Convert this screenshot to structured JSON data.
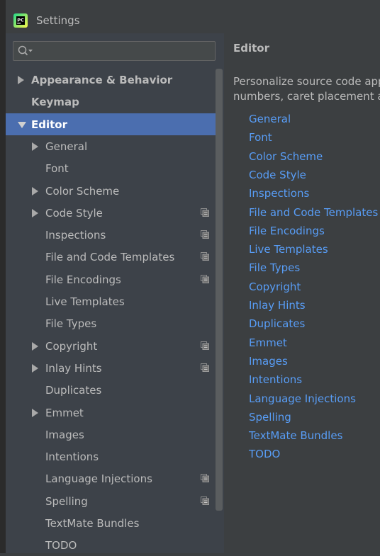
{
  "window": {
    "title": "Settings",
    "app_icon": "pycharm-logo"
  },
  "search": {
    "placeholder": "",
    "value": ""
  },
  "tree": [
    {
      "label": "Appearance & Behavior",
      "bold": true,
      "expander": "collapsed",
      "level": 0,
      "project_icon": false,
      "selected": false
    },
    {
      "label": "Keymap",
      "bold": true,
      "expander": "none",
      "level": 0,
      "project_icon": false,
      "selected": false
    },
    {
      "label": "Editor",
      "bold": true,
      "expander": "expanded",
      "level": 0,
      "project_icon": false,
      "selected": true
    },
    {
      "label": "General",
      "bold": false,
      "expander": "collapsed",
      "level": 1,
      "project_icon": false,
      "selected": false
    },
    {
      "label": "Font",
      "bold": false,
      "expander": "none",
      "level": 1,
      "project_icon": false,
      "selected": false
    },
    {
      "label": "Color Scheme",
      "bold": false,
      "expander": "collapsed",
      "level": 1,
      "project_icon": false,
      "selected": false
    },
    {
      "label": "Code Style",
      "bold": false,
      "expander": "collapsed",
      "level": 1,
      "project_icon": true,
      "selected": false
    },
    {
      "label": "Inspections",
      "bold": false,
      "expander": "none",
      "level": 1,
      "project_icon": true,
      "selected": false
    },
    {
      "label": "File and Code Templates",
      "bold": false,
      "expander": "none",
      "level": 1,
      "project_icon": true,
      "selected": false
    },
    {
      "label": "File Encodings",
      "bold": false,
      "expander": "none",
      "level": 1,
      "project_icon": true,
      "selected": false
    },
    {
      "label": "Live Templates",
      "bold": false,
      "expander": "none",
      "level": 1,
      "project_icon": false,
      "selected": false
    },
    {
      "label": "File Types",
      "bold": false,
      "expander": "none",
      "level": 1,
      "project_icon": false,
      "selected": false
    },
    {
      "label": "Copyright",
      "bold": false,
      "expander": "collapsed",
      "level": 1,
      "project_icon": true,
      "selected": false
    },
    {
      "label": "Inlay Hints",
      "bold": false,
      "expander": "collapsed",
      "level": 1,
      "project_icon": true,
      "selected": false
    },
    {
      "label": "Duplicates",
      "bold": false,
      "expander": "none",
      "level": 1,
      "project_icon": false,
      "selected": false
    },
    {
      "label": "Emmet",
      "bold": false,
      "expander": "collapsed",
      "level": 1,
      "project_icon": false,
      "selected": false
    },
    {
      "label": "Images",
      "bold": false,
      "expander": "none",
      "level": 1,
      "project_icon": false,
      "selected": false
    },
    {
      "label": "Intentions",
      "bold": false,
      "expander": "none",
      "level": 1,
      "project_icon": false,
      "selected": false
    },
    {
      "label": "Language Injections",
      "bold": false,
      "expander": "none",
      "level": 1,
      "project_icon": true,
      "selected": false
    },
    {
      "label": "Spelling",
      "bold": false,
      "expander": "none",
      "level": 1,
      "project_icon": true,
      "selected": false
    },
    {
      "label": "TextMate Bundles",
      "bold": false,
      "expander": "none",
      "level": 1,
      "project_icon": false,
      "selected": false
    },
    {
      "label": "TODO",
      "bold": false,
      "expander": "none",
      "level": 1,
      "project_icon": false,
      "selected": false
    }
  ],
  "content": {
    "title": "Editor",
    "description_line1": "Personalize source code app",
    "description_line2": "numbers, caret placement ar",
    "links": [
      "General",
      "Font",
      "Color Scheme",
      "Code Style",
      "Inspections",
      "File and Code Templates",
      "File Encodings",
      "Live Templates",
      "File Types",
      "Copyright",
      "Inlay Hints",
      "Duplicates",
      "Emmet",
      "Images",
      "Intentions",
      "Language Injections",
      "Spelling",
      "TextMate Bundles",
      "TODO"
    ]
  },
  "colors": {
    "background": "#3c3f41",
    "sidebar": "#3d4249",
    "selection": "#4b6eaf",
    "link": "#589df6",
    "text": "#bbbbbb"
  }
}
